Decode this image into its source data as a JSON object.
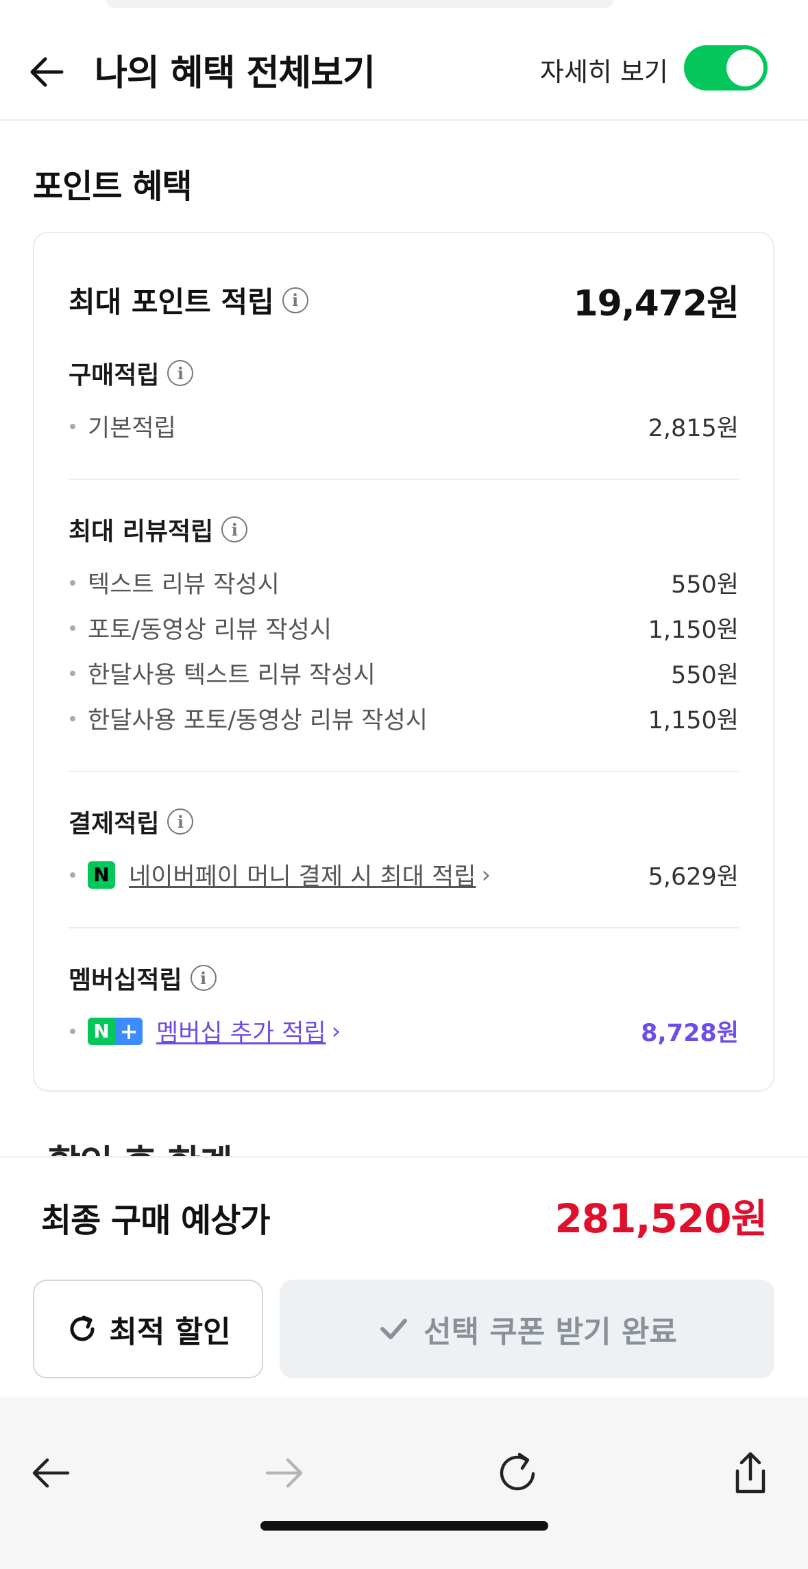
{
  "header": {
    "title": "나의 혜택 전체보기",
    "detail_label": "자세히 보기",
    "detail_toggle_on": true,
    "accent_color": "#03c75a"
  },
  "point_section": {
    "title": "포인트 혜택",
    "max_label": "최대 포인트 적립",
    "max_value": "19,472원",
    "groups": {
      "purchase": {
        "title": "구매적립",
        "items": [
          {
            "label": "기본적립",
            "value": "2,815원"
          }
        ]
      },
      "review": {
        "title": "최대 리뷰적립",
        "items": [
          {
            "label": "텍스트 리뷰 작성시",
            "value": "550원"
          },
          {
            "label": "포토/동영상 리뷰 작성시",
            "value": "1,150원"
          },
          {
            "label": "한달사용 텍스트 리뷰 작성시",
            "value": "550원"
          },
          {
            "label": "한달사용 포토/동영상 리뷰 작성시",
            "value": "1,150원"
          }
        ]
      },
      "payment": {
        "title": "결제적립",
        "items": [
          {
            "label": "네이버페이 머니 결제 시 최대 적립",
            "value": "5,629원"
          }
        ]
      },
      "membership": {
        "title": "멤버십적립",
        "items": [
          {
            "label": "멤버십 추가 적립",
            "value": "8,728원",
            "color": "#6c4de6"
          }
        ]
      }
    }
  },
  "peek_section_title": "할인 후 한계",
  "bottom": {
    "final_label": "최종 구매 예상가",
    "final_value": "281,520원",
    "final_color": "#e0102d",
    "optimal_button": "최적 할인",
    "coupon_button": "선택 쿠폰 받기 완료"
  },
  "browser": {
    "icons": [
      "back-icon",
      "forward-icon",
      "reload-icon",
      "share-icon"
    ]
  }
}
